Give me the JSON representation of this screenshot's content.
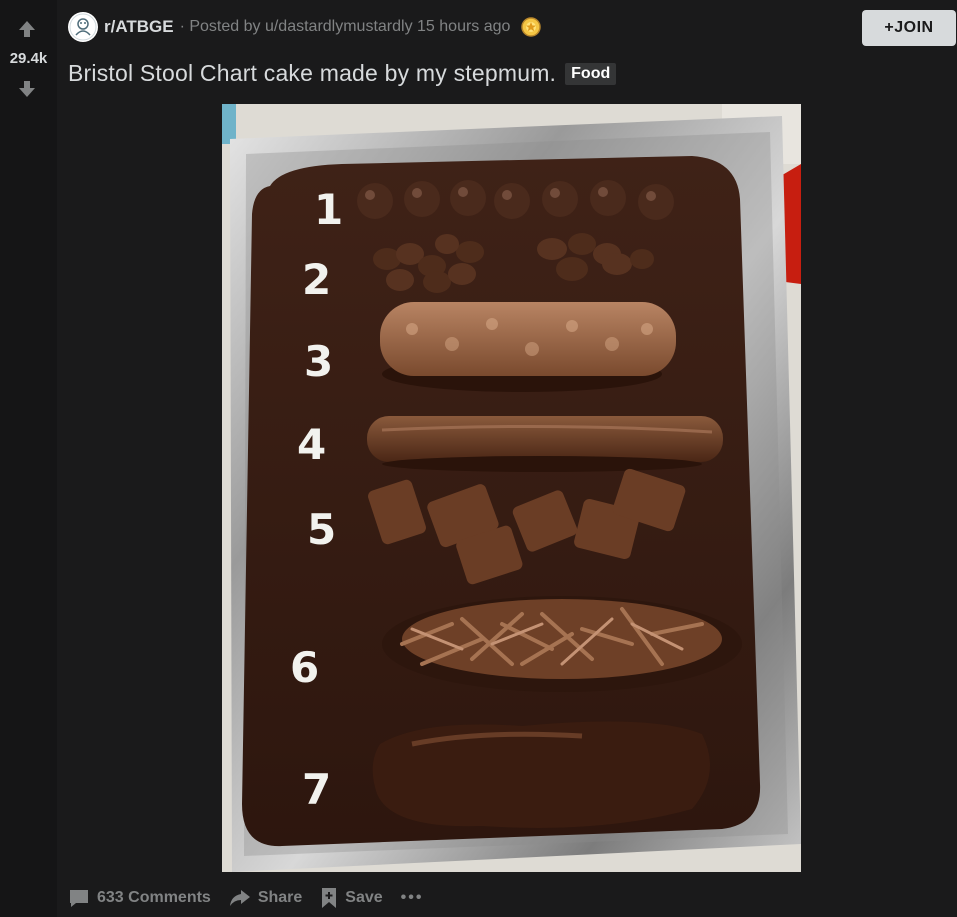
{
  "vote": {
    "score": "29.4k"
  },
  "post": {
    "subreddit": "r/ATBGE",
    "separator": "·",
    "posted_by": "Posted by u/dastardlymustardly",
    "time": "15 hours ago",
    "join_label": "JOIN",
    "join_plus": "+",
    "title": "Bristol Stool Chart cake made by my stepmum.",
    "flair": "Food"
  },
  "cake": {
    "numbers": [
      "1",
      "2",
      "3",
      "4",
      "5",
      "6",
      "7"
    ]
  },
  "actions": {
    "comments": "633 Comments",
    "share": "Share",
    "save": "Save",
    "more": "•••"
  },
  "colors": {
    "background": "#1a1a1b",
    "vote_column": "#151516",
    "text": "#d7dadc",
    "muted": "#818384",
    "flair_bg": "#343536"
  }
}
